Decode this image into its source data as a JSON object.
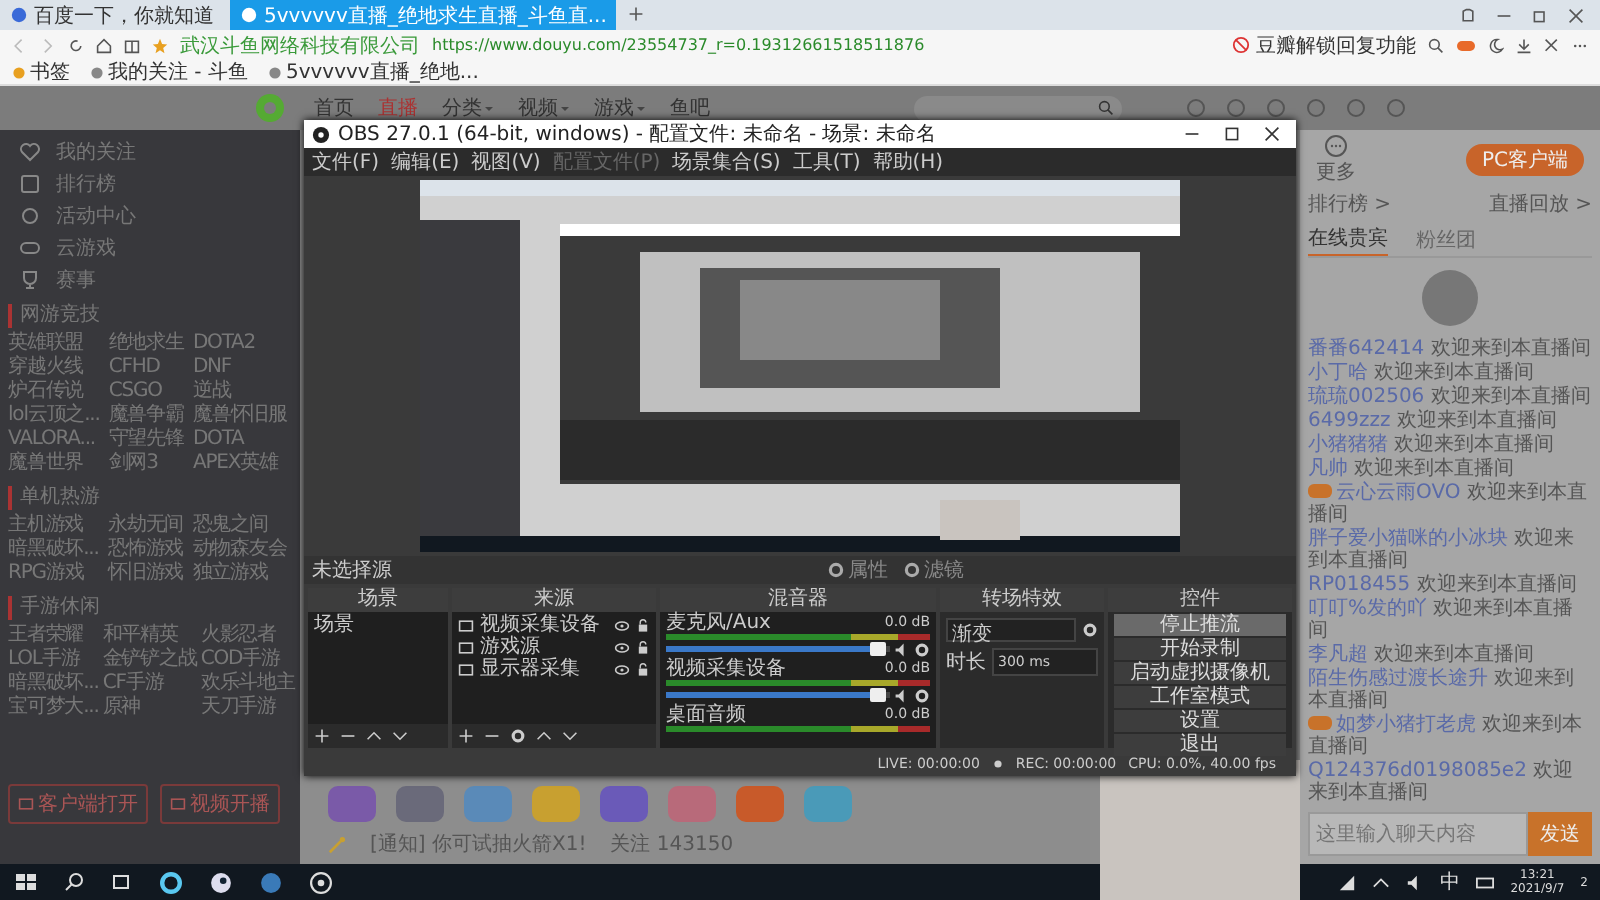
{
  "browser": {
    "tabs": [
      {
        "label": "百度一下，你就知道",
        "selected": false
      },
      {
        "label": "5vvvvvv直播_绝地求生直播_斗鱼直...",
        "selected": true
      }
    ],
    "site_identity": "武汉斗鱼网络科技有限公司",
    "url": "https://www.douyu.com/23554737_r=0.19312661518511876",
    "promo": "豆瓣解锁回复功能",
    "bookmarks": [
      "书签",
      "我的关注 - 斗鱼",
      "5vvvvvv直播_绝地..."
    ]
  },
  "site_nav": {
    "items": [
      {
        "label": "首页",
        "selected": false,
        "dropdown": false
      },
      {
        "label": "直播",
        "selected": true,
        "dropdown": false
      },
      {
        "label": "分类",
        "selected": false,
        "dropdown": true
      },
      {
        "label": "视频",
        "selected": false,
        "dropdown": true
      },
      {
        "label": "游戏",
        "selected": false,
        "dropdown": true
      },
      {
        "label": "鱼吧",
        "selected": false,
        "dropdown": false
      }
    ]
  },
  "sidebar": {
    "items": [
      "我的关注",
      "排行榜",
      "活动中心",
      "云游戏",
      "赛事"
    ],
    "sections": [
      {
        "title": "网游竞技",
        "games": [
          "英雄联盟",
          "绝地求生",
          "DOTA2",
          "穿越火线",
          "CFHD",
          "DNF",
          "炉石传说",
          "CSGO",
          "逆战",
          "lol云顶之...",
          "魔兽争霸",
          "魔兽怀旧服",
          "VALORA...",
          "守望先锋",
          "DOTA",
          "魔兽世界",
          "剑网3",
          "APEX英雄"
        ]
      },
      {
        "title": "单机热游",
        "games": [
          "主机游戏",
          "永劫无间",
          "恐鬼之间",
          "暗黑破坏...",
          "恐怖游戏",
          "动物森友会",
          "RPG游戏",
          "怀旧游戏",
          "独立游戏"
        ]
      },
      {
        "title": "手游休闲",
        "games": [
          "王者荣耀",
          "和平精英",
          "火影忍者",
          "LOL手游",
          "金铲铲之战",
          "COD手游",
          "暗黑破坏...",
          "CF手游",
          "欢乐斗地主",
          "宝可梦大...",
          "原神",
          "天刀手游"
        ]
      }
    ],
    "buttons": [
      "客户端打开",
      "视频开播"
    ]
  },
  "obs": {
    "title": "OBS 27.0.1 (64-bit, windows) - 配置文件: 未命名 - 场景: 未命名",
    "menu": [
      {
        "label": "文件(F)",
        "disabled": false
      },
      {
        "label": "编辑(E)",
        "disabled": false
      },
      {
        "label": "视图(V)",
        "disabled": false
      },
      {
        "label": "配置文件(P)",
        "disabled": true
      },
      {
        "label": "场景集合(S)",
        "disabled": false
      },
      {
        "label": "工具(T)",
        "disabled": false
      },
      {
        "label": "帮助(H)",
        "disabled": false
      }
    ],
    "source_toolbar": {
      "label": "未选择源",
      "buttons": [
        "属性",
        "滤镜"
      ]
    },
    "scenes": {
      "title": "场景",
      "items": [
        "场景"
      ]
    },
    "sources": {
      "title": "来源",
      "items": [
        "视频采集设备",
        "游戏源",
        "显示器采集"
      ]
    },
    "mixer": {
      "title": "混音器",
      "channels": [
        {
          "name": "麦克风/Aux",
          "reading": "0.0 dB",
          "level": 0.95
        },
        {
          "name": "视频采集设备",
          "reading": "0.0 dB",
          "level": 0.95
        },
        {
          "name": "桌面音频",
          "reading": "0.0 dB"
        }
      ]
    },
    "transitions": {
      "title": "转场特效",
      "type": "渐变",
      "duration_label": "时长",
      "duration": "300 ms"
    },
    "controls": {
      "title": "控件",
      "buttons": [
        {
          "label": "停止推流",
          "active": true
        },
        {
          "label": "开始录制",
          "active": false
        },
        {
          "label": "启动虚拟摄像机",
          "active": false
        },
        {
          "label": "工作室模式",
          "active": false
        },
        {
          "label": "设置",
          "active": false
        },
        {
          "label": "退出",
          "active": false
        }
      ]
    },
    "status": {
      "live": "LIVE: 00:00:00",
      "rec": "REC: 00:00:00",
      "cpu": "CPU: 0.0%, 40.00 fps"
    }
  },
  "bottom": {
    "notice": "[通知] 你可试抽火箭X1!",
    "stats": [
      "关注 143150"
    ]
  },
  "chat": {
    "more": "更多",
    "client_button": "PC客户端",
    "links": [
      "排行榜 >",
      "直播回放 >"
    ],
    "tabs": [
      {
        "label": "在线贵宾",
        "selected": true
      },
      {
        "label": "粉丝团",
        "selected": false
      }
    ],
    "messages": [
      {
        "user": "番番642414",
        "text": "欢迎来到本直播间",
        "badge": false
      },
      {
        "user": "小丁哈",
        "text": "欢迎来到本直播间",
        "badge": false
      },
      {
        "user": "琉琉002506",
        "text": "欢迎来到本直播间",
        "badge": false
      },
      {
        "user": "6499zzz",
        "text": "欢迎来到本直播间",
        "badge": false
      },
      {
        "user": "小猪猪猪",
        "text": "欢迎来到本直播间",
        "badge": false
      },
      {
        "user": "凡帅",
        "text": "欢迎来到本直播间",
        "badge": false
      },
      {
        "user": "云心云雨OVO",
        "text": "欢迎来到本直播间",
        "badge": true
      },
      {
        "user": "胖子爱小猫咪的小冰块",
        "text": "欢迎来到本直播间",
        "badge": false
      },
      {
        "user": "RP018455",
        "text": "欢迎来到本直播间",
        "badge": false
      },
      {
        "user": "叮叮%发的吖",
        "text": "欢迎来到本直播间",
        "badge": false
      },
      {
        "user": "李凡超",
        "text": "欢迎来到本直播间",
        "badge": false
      },
      {
        "user": "陌生伤感过渡长途升",
        "text": "欢迎来到本直播间",
        "badge": false
      },
      {
        "user": "如梦小猪打老虎",
        "text": "欢迎来到本直播间",
        "badge": true
      },
      {
        "user": "Q124376d0198085e2",
        "text": "欢迎来到本直播间",
        "badge": false
      }
    ],
    "input_placeholder": "这里输入聊天内容",
    "send": "发送"
  },
  "taskbar": {
    "ime": "中",
    "time": "13:21",
    "date": "2021/9/7",
    "notifications": "2"
  }
}
